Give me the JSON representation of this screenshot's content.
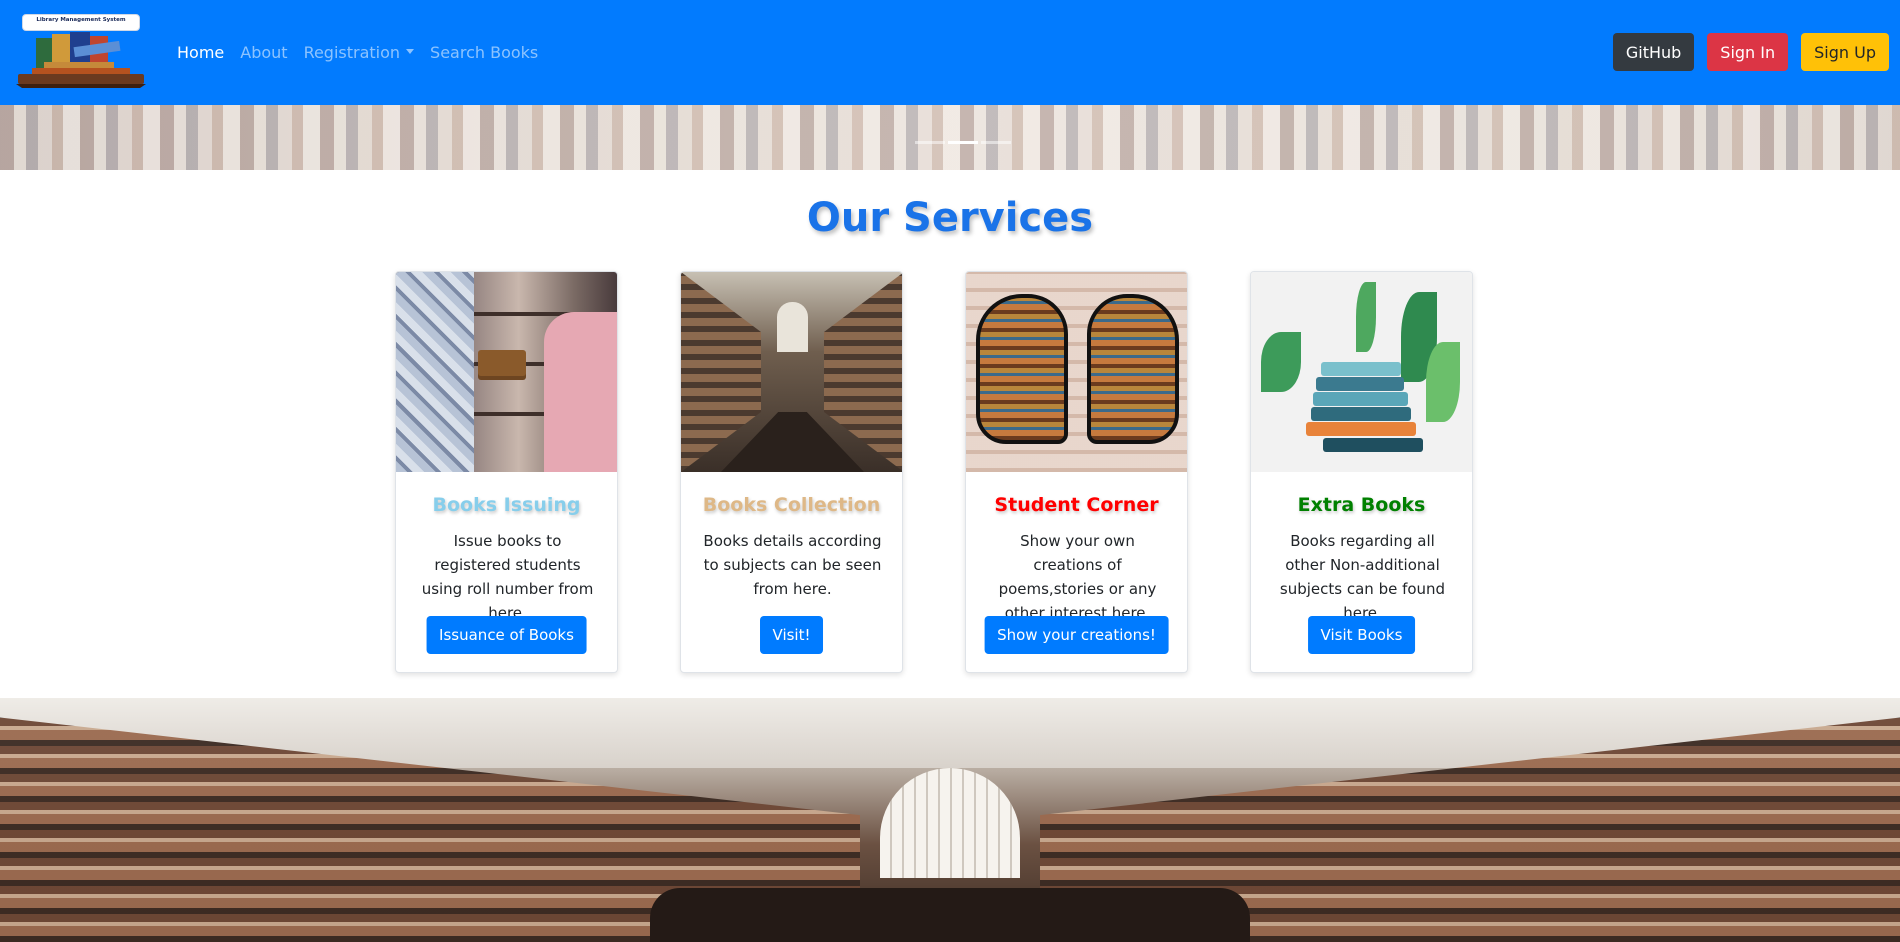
{
  "brand": {
    "logo_text": "Library Management System"
  },
  "nav": {
    "items": [
      {
        "label": "Home",
        "active": true
      },
      {
        "label": "About",
        "active": false
      },
      {
        "label": "Registration",
        "active": false,
        "dropdown": true
      },
      {
        "label": "Search Books",
        "active": false
      }
    ],
    "actions": {
      "github": "GitHub",
      "signin": "Sign In",
      "signup": "Sign Up"
    },
    "colors": {
      "navbar_bg": "#027bfe",
      "github_bg": "#343a40",
      "signin_bg": "#dc3545",
      "signup_bg": "#ffc107"
    }
  },
  "carousel": {
    "slide_count": 3,
    "active_index": 1
  },
  "services": {
    "title": "Our Services",
    "cards": [
      {
        "title": "Books Issuing",
        "title_color": "#87ceeb",
        "text": "Issue books to registered students using roll number from here.",
        "button": "Issuance of Books"
      },
      {
        "title": "Books Collection",
        "title_color": "#deb887",
        "text": "Books details according to subjects can be seen from here.",
        "button": "Visit!"
      },
      {
        "title": "Student Corner",
        "title_color": "#ff0000",
        "text": "Show your own creations of poems,stories or any other interest here.",
        "button": "Show your creations!"
      },
      {
        "title": "Extra Books",
        "title_color": "#008000",
        "text": "Books regarding all other Non-additional subjects can be found here.",
        "button": "Visit Books"
      }
    ]
  }
}
